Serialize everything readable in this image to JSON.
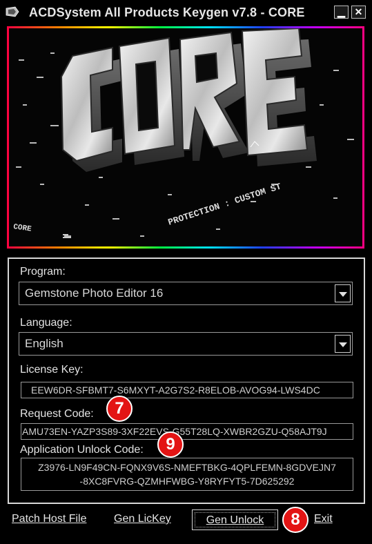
{
  "window": {
    "title": "ACDSystem All Products Keygen v7.8 - CORE",
    "minimize_glyph": "▁",
    "close_glyph": "✕"
  },
  "banner": {
    "logo_text": "CORE",
    "scroller_text": "PROTECTION : CUSTOM ST",
    "corner_text": "CORE"
  },
  "form": {
    "program_label": "Program:",
    "program_value": "Gemstone Photo Editor 16",
    "language_label": "Language:",
    "language_value": "English",
    "license_label": "License Key:",
    "license_value": "EEW6DR-SFBMT7-S6MXYT-A2G7S2-R8ELOB-AVOG94-LWS4DC",
    "request_label": "Request Code:",
    "request_value": "AMU73EN-YAZP3S89-3XF22EVS-G55T28LQ-XWBR2GZU-Q58AJT9J",
    "unlock_label": "Application Unlock Code:",
    "unlock_line1": "Z3976-LN9F49CN-FQNX9V6S-NMEFTBKG-4QPLFEMN-8GDVEJN7",
    "unlock_line2": "-8XC8FVRG-QZMHFWBG-Y8RYFYT5-7D625292"
  },
  "buttons": {
    "patch_host": "Patch Host File",
    "gen_lickey": "Gen LicKey",
    "gen_unlock": "Gen Unlock",
    "exit": "Exit"
  },
  "annotations": {
    "badge_7": "7",
    "badge_8": "8",
    "badge_9": "9"
  },
  "colors": {
    "background": "#000000",
    "text": "#e0e0e0",
    "badge": "#e31414"
  }
}
